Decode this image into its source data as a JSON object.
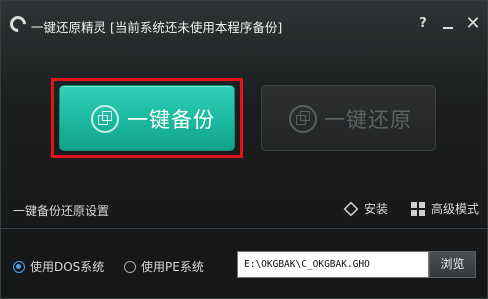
{
  "window": {
    "title": "一键还原精灵 [当前系统还未使用本程序备份]",
    "help_label": "?",
    "close_label": "✕"
  },
  "actions": {
    "backup_label": "一键备份",
    "restore_label": "一键还原"
  },
  "settings": {
    "title": "一键备份还原设置",
    "install_label": "安装",
    "advanced_label": "高级模式"
  },
  "options": {
    "dos_label": "使用DOS系统",
    "pe_label": "使用PE系统",
    "selected": "dos",
    "path_value": "E:\\OKGBAK\\C_OKGBAK.GHO",
    "browse_label": "浏览"
  },
  "colors": {
    "accent": "#1bb79e",
    "highlight_frame": "#e0151c",
    "radio_selected": "#4aa3e8"
  },
  "icons": {
    "app_logo": "app-logo-icon",
    "backup": "backup-icon",
    "restore": "restore-icon",
    "install": "cube-icon",
    "advanced": "grid-icon"
  }
}
